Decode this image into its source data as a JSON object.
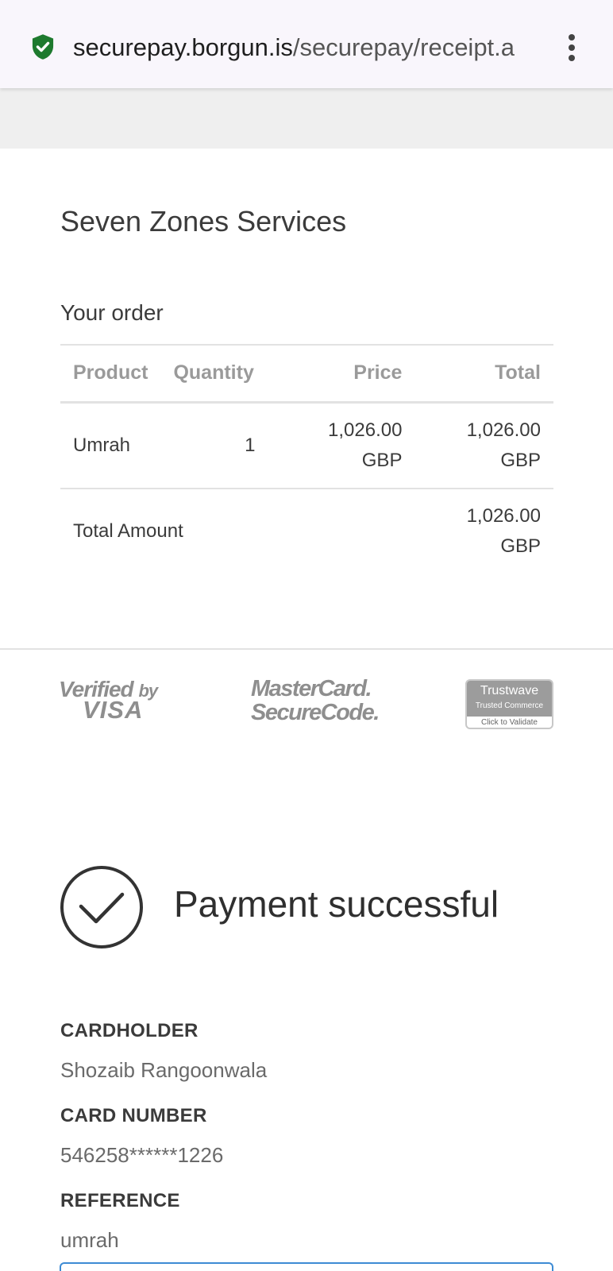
{
  "browser": {
    "url_host": "securepay.borgun.is",
    "url_path": "/securepay/receipt.a",
    "secure_icon": "shield-check-icon",
    "menu_icon": "more-vert-icon"
  },
  "merchant": "Seven Zones Services",
  "order": {
    "title": "Your order",
    "headers": {
      "product": "Product",
      "quantity": "Quantity",
      "price": "Price",
      "total": "Total"
    },
    "items": [
      {
        "product": "Umrah",
        "quantity": "1",
        "price_amount": "1,026.00",
        "price_currency": "GBP",
        "total_amount": "1,026.00",
        "total_currency": "GBP"
      }
    ],
    "total_label": "Total Amount",
    "total_amount": "1,026.00",
    "total_currency": "GBP"
  },
  "badges": {
    "visa_line1": "Verified",
    "visa_by": "by",
    "visa_line2": "VISA",
    "mc_line1": "MasterCard.",
    "mc_line2": "SecureCode.",
    "tw_name": "Trustwave",
    "tw_sub": "Trusted Commerce",
    "tw_cta": "Click to Validate"
  },
  "status": {
    "icon": "check-circle-icon",
    "text": "Payment successful"
  },
  "details": {
    "cardholder_label": "CARDHOLDER",
    "cardholder": "Shozaib Rangoonwala",
    "card_number_label": "CARD NUMBER",
    "card_number": "546258******1226",
    "reference_label": "REFERENCE",
    "reference": "umrah"
  },
  "colors": {
    "secure_green": "#1e7a2e",
    "badge_gray": "#8e8e8e",
    "focus_blue": "#3d8bd4"
  }
}
